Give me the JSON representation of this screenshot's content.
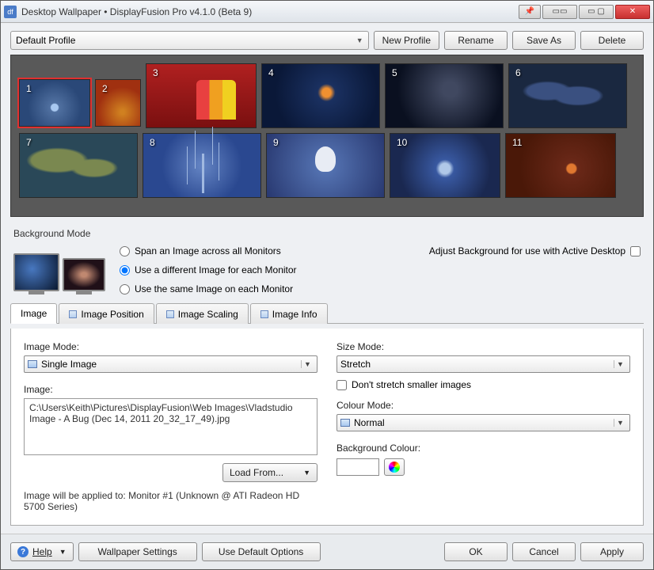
{
  "window": {
    "title": "Desktop Wallpaper • DisplayFusion Pro v4.1.0 (Beta 9)"
  },
  "profile": {
    "selected": "Default Profile",
    "buttons": {
      "new": "New Profile",
      "rename": "Rename",
      "saveas": "Save As",
      "delete": "Delete"
    }
  },
  "monitors": [
    {
      "n": "1"
    },
    {
      "n": "2"
    },
    {
      "n": "3"
    },
    {
      "n": "4"
    },
    {
      "n": "5"
    },
    {
      "n": "6"
    },
    {
      "n": "7"
    },
    {
      "n": "8"
    },
    {
      "n": "9"
    },
    {
      "n": "10"
    },
    {
      "n": "11"
    }
  ],
  "bgmode": {
    "section_label": "Background Mode",
    "opts": {
      "span": "Span an Image across all Monitors",
      "diff": "Use a different Image for each Monitor",
      "same": "Use the same Image on each Monitor"
    },
    "selected": "diff",
    "adjust": "Adjust Background for use with Active Desktop"
  },
  "tabs": {
    "image": "Image",
    "pos": "Image Position",
    "scale": "Image Scaling",
    "info": "Image Info"
  },
  "imgtab": {
    "mode_label": "Image Mode:",
    "mode_value": "Single Image",
    "image_label": "Image:",
    "image_path": "C:\\Users\\Keith\\Pictures\\DisplayFusion\\Web Images\\Vladstudio Image - A Bug (Dec 14, 2011 20_32_17_49).jpg",
    "load_from": "Load From...",
    "status": "Image will be applied to: Monitor #1 (Unknown @ ATI Radeon HD 5700 Series)",
    "size_label": "Size Mode:",
    "size_value": "Stretch",
    "dont_stretch": "Don't stretch smaller images",
    "colour_label": "Colour Mode:",
    "colour_value": "Normal",
    "bgcolour_label": "Background Colour:"
  },
  "footer": {
    "help": "Help",
    "wallpaper": "Wallpaper Settings",
    "defaults": "Use Default Options",
    "ok": "OK",
    "cancel": "Cancel",
    "apply": "Apply"
  }
}
